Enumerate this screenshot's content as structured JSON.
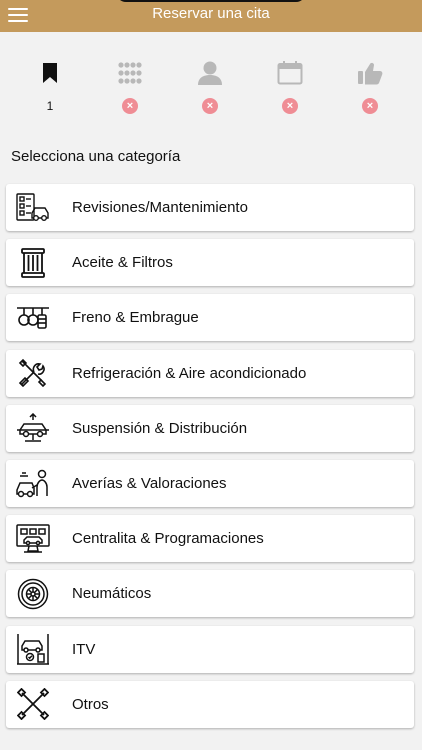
{
  "header": {
    "title": "Reservar una cita",
    "menu_icon": "hamburger-icon",
    "background": "#c49a5c"
  },
  "steps": [
    {
      "icon": "bookmark-icon",
      "status": "1",
      "active": true
    },
    {
      "icon": "grid-icon",
      "status": "×",
      "active": false
    },
    {
      "icon": "user-icon",
      "status": "×",
      "active": false
    },
    {
      "icon": "calendar-icon",
      "status": "×",
      "active": false
    },
    {
      "icon": "thumbs-up-icon",
      "status": "×",
      "active": false
    }
  ],
  "section_title": "Selecciona una categoría",
  "categories": [
    {
      "label": "Revisiones/Mantenimiento",
      "icon": "checklist-car-icon"
    },
    {
      "label": "Aceite & Filtros",
      "icon": "oil-filter-icon"
    },
    {
      "label": "Freno & Embrague",
      "icon": "brake-icon"
    },
    {
      "label": "Refrigeración & Aire acondicionado",
      "icon": "wrench-screwdriver-icon"
    },
    {
      "label": "Suspensión & Distribución",
      "icon": "car-lift-icon"
    },
    {
      "label": "Averías & Valoraciones",
      "icon": "mechanic-car-icon"
    },
    {
      "label": "Centralita & Programaciones",
      "icon": "diagnostic-computer-icon"
    },
    {
      "label": "Neumáticos",
      "icon": "tire-icon"
    },
    {
      "label": "ITV",
      "icon": "inspection-lift-icon"
    },
    {
      "label": "Otros",
      "icon": "cross-wrench-icon"
    }
  ],
  "colors": {
    "accent": "#c49a5c",
    "error": "#ef8d95",
    "inactive_icon": "#b8b8b8"
  }
}
